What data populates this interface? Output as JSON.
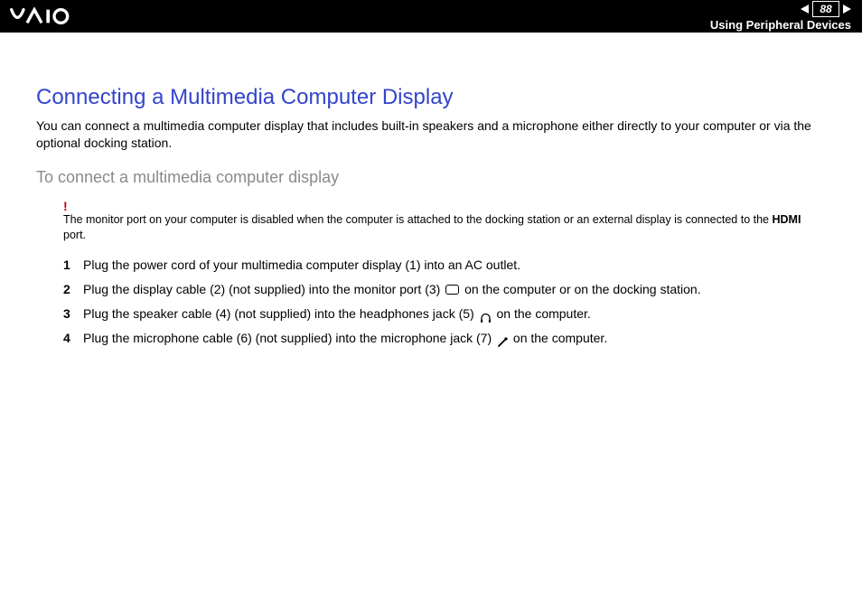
{
  "header": {
    "page_number": "88",
    "section_title": "Using Peripheral Devices"
  },
  "content": {
    "title": "Connecting a Multimedia Computer Display",
    "intro": "You can connect a multimedia computer display that includes built-in speakers and a microphone either directly to your computer or via the optional docking station.",
    "subhead": "To connect a multimedia computer display",
    "note": {
      "prefix": "The monitor port on your computer is disabled when the computer is attached to the docking station or an external display is connected to the ",
      "bold": "HDMI",
      "suffix": " port."
    },
    "steps": [
      {
        "pre": "Plug the power cord of your multimedia computer display (1) into an AC outlet.",
        "icon": null,
        "post": ""
      },
      {
        "pre": "Plug the display cable (2) (not supplied) into the monitor port (3) ",
        "icon": "port",
        "post": " on the computer or on the docking station."
      },
      {
        "pre": "Plug the speaker cable (4) (not supplied) into the headphones jack (5) ",
        "icon": "headphones",
        "post": " on the computer."
      },
      {
        "pre": "Plug the microphone cable (6) (not supplied) into the microphone jack (7) ",
        "icon": "mic",
        "post": " on the computer."
      }
    ]
  }
}
